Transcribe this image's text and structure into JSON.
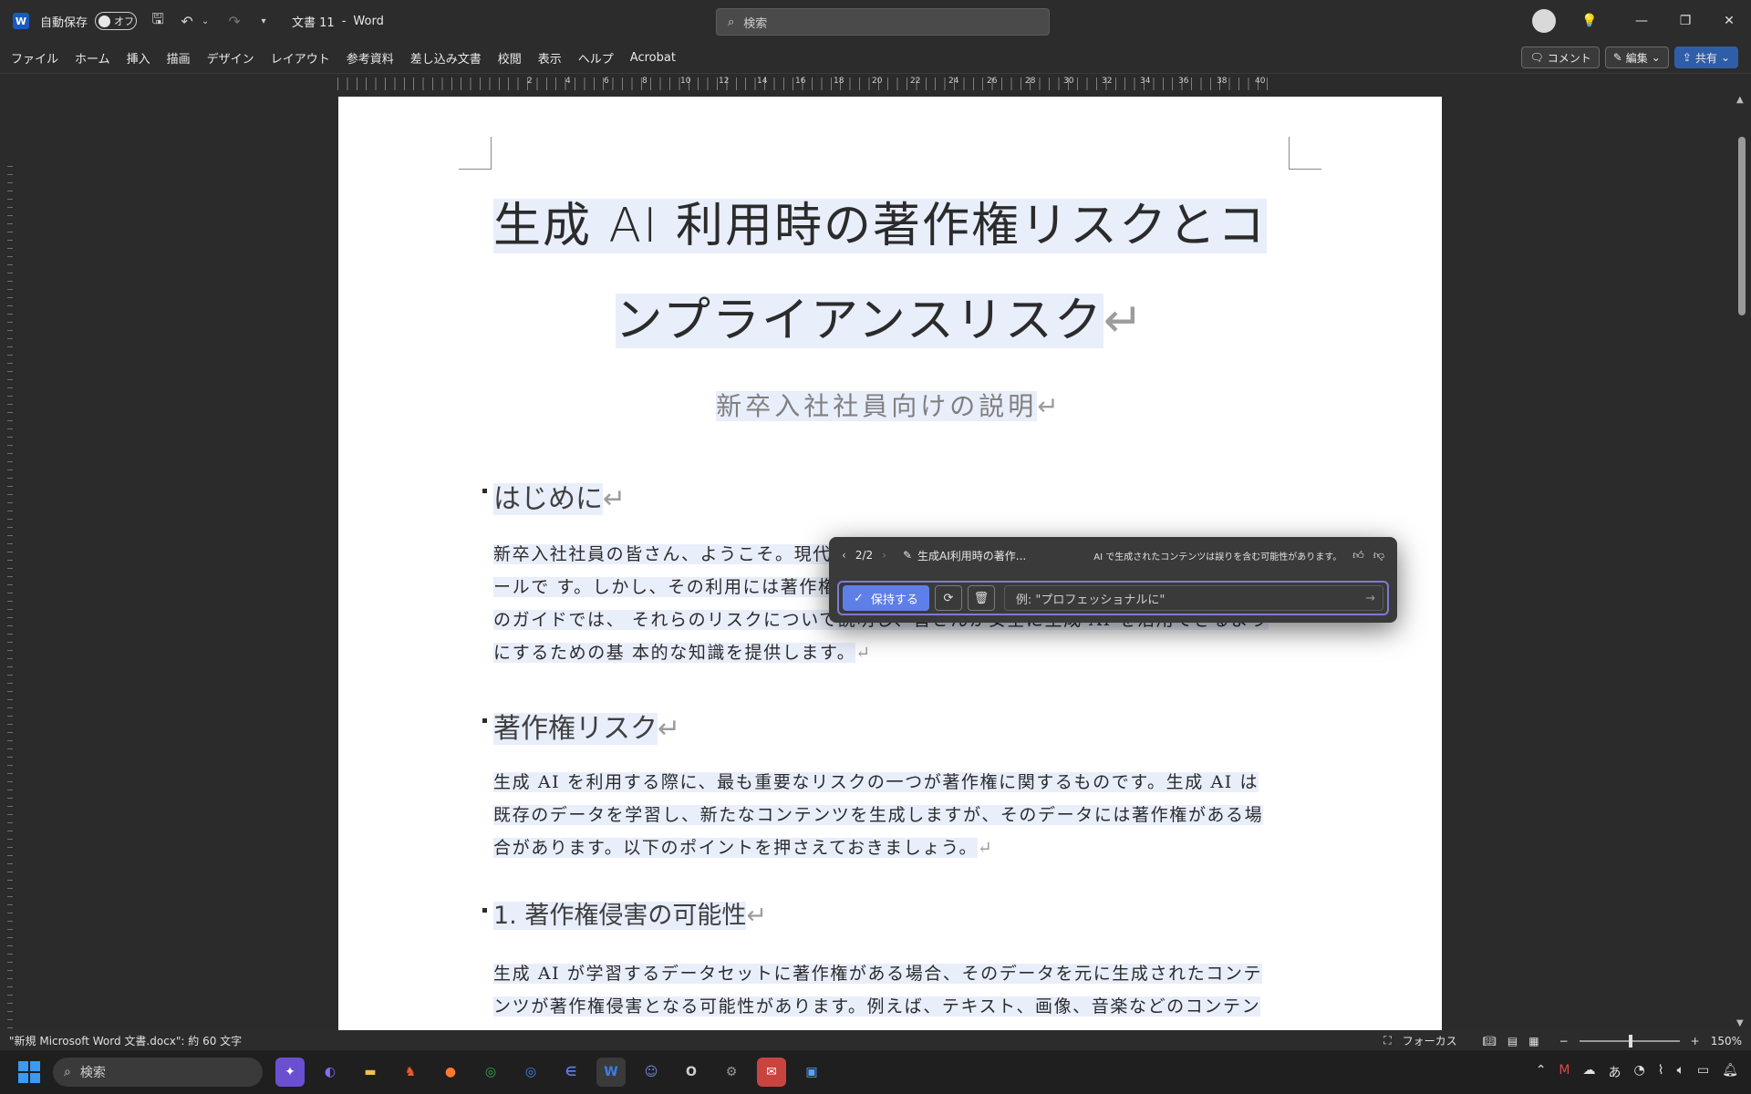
{
  "titlebar": {
    "autosave_label": "自動保存",
    "autosave_state": "オフ",
    "doc_name": "文書 11",
    "separator": "-",
    "app_name": "Word",
    "search_placeholder": "検索"
  },
  "menu": {
    "items": [
      "ファイル",
      "ホーム",
      "挿入",
      "描画",
      "デザイン",
      "レイアウト",
      "参考資料",
      "差し込み文書",
      "校閲",
      "表示",
      "ヘルプ",
      "Acrobat"
    ],
    "comment_label": "コメント",
    "edit_label": "編集",
    "share_label": "共有"
  },
  "ruler": {
    "numbers": [
      "2",
      "4",
      "6",
      "8",
      "10",
      "12",
      "14",
      "16",
      "18",
      "20",
      "22",
      "24",
      "26",
      "28",
      "30",
      "32",
      "34",
      "36",
      "38",
      "40"
    ]
  },
  "document": {
    "title_line1": "生成 AI 利用時の著作権リスクとコ",
    "title_line2": "ンプライアンスリスク",
    "subtitle": "新卒入社社員向けの説明",
    "heading_intro": "はじめに",
    "para_intro": "新卒入社社員の皆さん、ようこそ。現代のビジネス環境において、生成AIは非常に便利なツールで す。しかし、その利用には著作権やコンプライアンスに関するリスクが伴います。このガイドでは、 それらのリスクについて説明し、皆さんが安全に生成 AI を活用できるようにするための基 本的な知識を提供します。",
    "heading_copyright": "著作権リスク",
    "para_copyright": "生成 AI を利用する際に、最も重要なリスクの一つが著作権に関するものです。生成 AI は既存のデータを学習し、新たなコンテンツを生成しますが、そのデータには著作権がある場合があります。以下のポイントを押さえておきましょう。",
    "heading_infringe": "1.  著作権侵害の可能性",
    "para_infringe": "生成 AI が学習するデータセットに著作権がある場合、そのデータを元に生成されたコンテンツが著作権侵害となる可能性があります。例えば、テキスト、画像、音楽などのコンテン",
    "para_mark": "↵"
  },
  "copilot": {
    "counter": "2/2",
    "draft_title": "生成AI利用時の著作...",
    "notice": "AI で生成されたコンテンツは誤りを含む可能性があります。",
    "keep_label": "保持する",
    "input_placeholder": "例: \"プロフェッショナルに\"",
    "accent_color": "#7e7ad6"
  },
  "status": {
    "doc_info": "\"新規 Microsoft Word 文書.docx\": 約 60 文字",
    "focus_label": "フォーカス",
    "zoom": "150%"
  },
  "taskbar": {
    "search_label": "検索",
    "tray_ime": "あ"
  }
}
